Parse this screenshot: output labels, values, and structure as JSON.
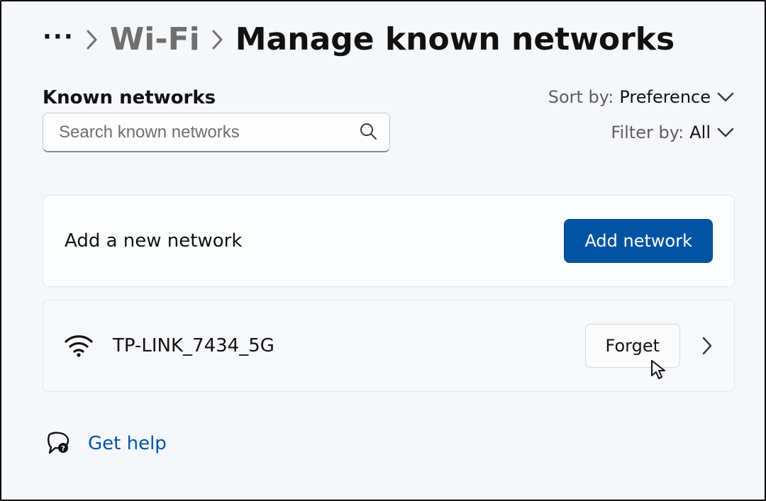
{
  "breadcrumb": {
    "parent": "Wi-Fi",
    "current": "Manage known networks"
  },
  "section_title": "Known networks",
  "search": {
    "placeholder": "Search known networks"
  },
  "sort": {
    "label": "Sort by:",
    "value": "Preference"
  },
  "filter": {
    "label": "Filter by:",
    "value": "All"
  },
  "add_card": {
    "label": "Add a new network",
    "button": "Add network"
  },
  "networks": [
    {
      "name": "TP-LINK_7434_5G",
      "forget_label": "Forget"
    }
  ],
  "help": {
    "label": "Get help"
  }
}
